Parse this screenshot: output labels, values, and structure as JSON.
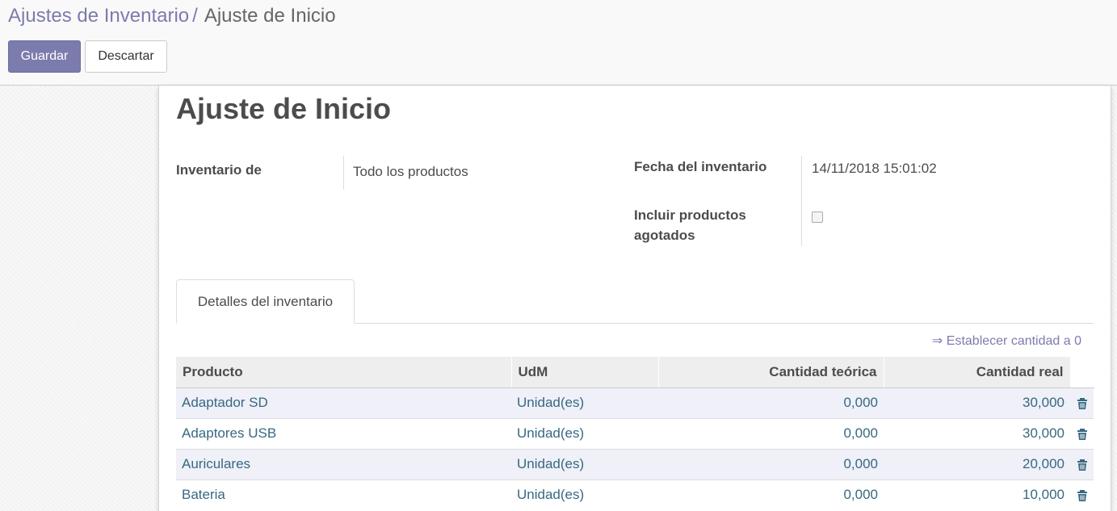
{
  "breadcrumb": {
    "parent": "Ajustes de Inventario",
    "separator": "/",
    "current": "Ajuste de Inicio"
  },
  "toolbar": {
    "save_label": "Guardar",
    "discard_label": "Descartar"
  },
  "form": {
    "title": "Ajuste de Inicio",
    "inventory_of_label": "Inventario de",
    "inventory_of_value": "Todo los productos",
    "date_label": "Fecha del inventario",
    "date_value": "14/11/2018 15:01:02",
    "include_exhausted_label_line1": "Incluir productos",
    "include_exhausted_label_line2": "agotados",
    "include_exhausted_checked": false
  },
  "tabs": [
    {
      "label": "Detalles del inventario",
      "active": true
    }
  ],
  "set_zero_link": "⇒ Establecer cantidad a 0",
  "table": {
    "columns": [
      "Producto",
      "UdM",
      "Cantidad teórica",
      "Cantidad real"
    ],
    "rows": [
      {
        "product": "Adaptador SD",
        "uom": "Unidad(es)",
        "theoretical": "0,000",
        "real": "30,000"
      },
      {
        "product": "Adaptores USB",
        "uom": "Unidad(es)",
        "theoretical": "0,000",
        "real": "30,000"
      },
      {
        "product": "Auriculares",
        "uom": "Unidad(es)",
        "theoretical": "0,000",
        "real": "20,000"
      },
      {
        "product": "Bateria",
        "uom": "Unidad(es)",
        "theoretical": "0,000",
        "real": "10,000"
      }
    ]
  },
  "icons": {
    "delete": "trash-icon"
  },
  "colors": {
    "primary": "#7c7bad",
    "link": "#376982",
    "row_stripe": "#eff0f8"
  }
}
